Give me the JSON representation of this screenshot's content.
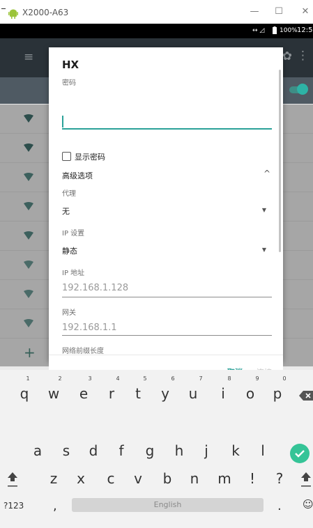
{
  "window": {
    "title": "X2000-A63",
    "minimize": "—",
    "maximize": "☐",
    "close": "✕"
  },
  "status_bar": {
    "network": "↔ ◿",
    "battery": "100%",
    "time": "12:5"
  },
  "app_bar": {
    "menu_icon": "≡",
    "settings_icon": "✿",
    "more_icon": "⋮"
  },
  "wifi_list": {
    "add_icon": "+"
  },
  "dialog": {
    "title": "HX",
    "password_label": "密码",
    "password_value": "",
    "show_password_label": "显示密码",
    "advanced_label": "高级选项",
    "advanced_chevron": "^",
    "proxy_label": "代理",
    "proxy_value": "无",
    "ip_settings_label": "IP 设置",
    "ip_settings_value": "静态",
    "dropdown_arrow": "▼",
    "ip_address_label": "IP 地址",
    "ip_address_value": "192.168.1.128",
    "gateway_label": "网关",
    "gateway_value": "192.168.1.1",
    "prefix_label": "网络前缀长度",
    "cancel_label": "取消",
    "connect_label": "连接"
  },
  "keyboard": {
    "row1": [
      "q",
      "w",
      "e",
      "r",
      "t",
      "y",
      "u",
      "i",
      "o",
      "p"
    ],
    "row1_hints": [
      "1",
      "2",
      "3",
      "4",
      "5",
      "6",
      "7",
      "8",
      "9",
      "0"
    ],
    "row2": [
      "a",
      "s",
      "d",
      "f",
      "g",
      "h",
      "j",
      "k",
      "l"
    ],
    "row3": [
      "z",
      "x",
      "c",
      "v",
      "b",
      "n",
      "m",
      "!",
      "?"
    ],
    "symbols_label": "?123",
    "comma": ",",
    "space_label": "English",
    "period": ".",
    "emoji_icon": "☺"
  },
  "colors": {
    "accent": "#2aa198",
    "app_bar": "#2a3238",
    "enter": "#35c497"
  }
}
